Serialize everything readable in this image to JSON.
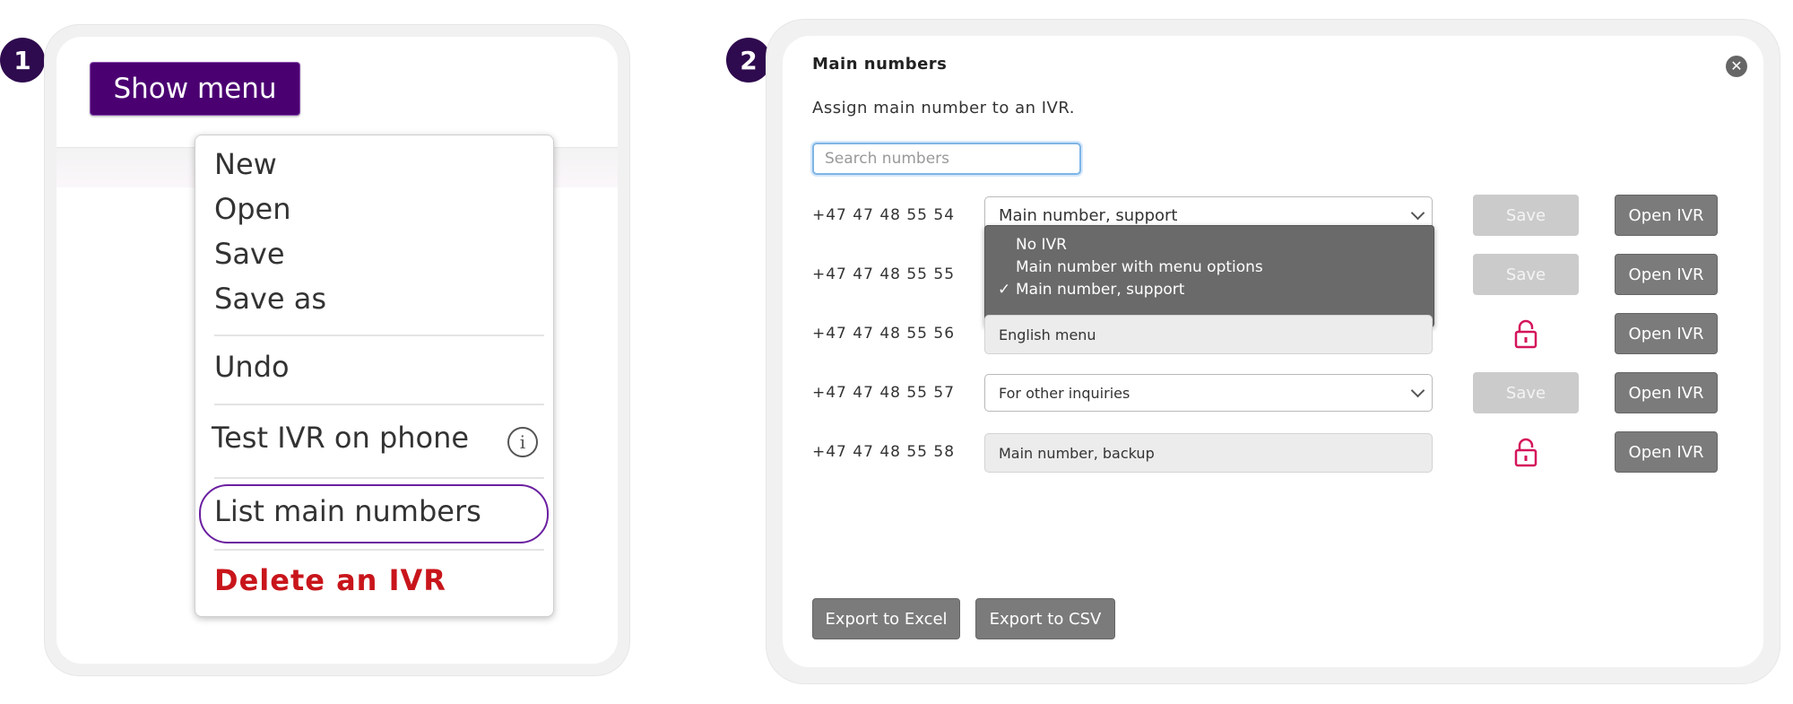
{
  "steps": [
    "1",
    "2"
  ],
  "panel1": {
    "show_menu_label": "Show menu",
    "menu": {
      "new": "New",
      "open": "Open",
      "save": "Save",
      "save_as": "Save as",
      "undo": "Undo",
      "test_ivr": "Test IVR on phone",
      "list_main_numbers": "List main numbers",
      "delete_ivr": "Delete an IVR"
    },
    "highlighted_item": "List main numbers"
  },
  "panel2": {
    "title": "Main numbers",
    "subtitle": "Assign main number to an IVR.",
    "search_placeholder": "Search numbers",
    "save_label": "Save",
    "open_ivr_label": "Open IVR",
    "rows": [
      {
        "number": "+47  47  48  55  54",
        "control": "select",
        "value": "Main number, support",
        "locked": false
      },
      {
        "number": "+47  47  48  55  55",
        "control": "select",
        "value": "",
        "locked": false
      },
      {
        "number": "+47  47  48  55  56",
        "control": "readonly",
        "value": "English menu",
        "locked": true
      },
      {
        "number": "+47  47  48  55  57",
        "control": "select",
        "value": "For other inquiries",
        "locked": false
      },
      {
        "number": "+47  47  48  55  58",
        "control": "readonly",
        "value": "Main number, backup",
        "locked": true
      }
    ],
    "dropdown_options": [
      "No IVR",
      "Main number with menu options",
      "Main number, support"
    ],
    "dropdown_selected": "Main number, support",
    "export_excel": "Export to Excel",
    "export_csv": "Export to CSV"
  },
  "colors": {
    "brand_purple": "#4b0072",
    "badge": "#2e0a4e",
    "delete_red": "#c8151b",
    "lock_pink": "#d4145a",
    "button_gray": "#7b7b7b",
    "disabled_gray": "#cbcbcb"
  },
  "icons": [
    "info-icon",
    "close-icon",
    "lock-icon",
    "chevron-down-icon",
    "checkmark-icon"
  ]
}
